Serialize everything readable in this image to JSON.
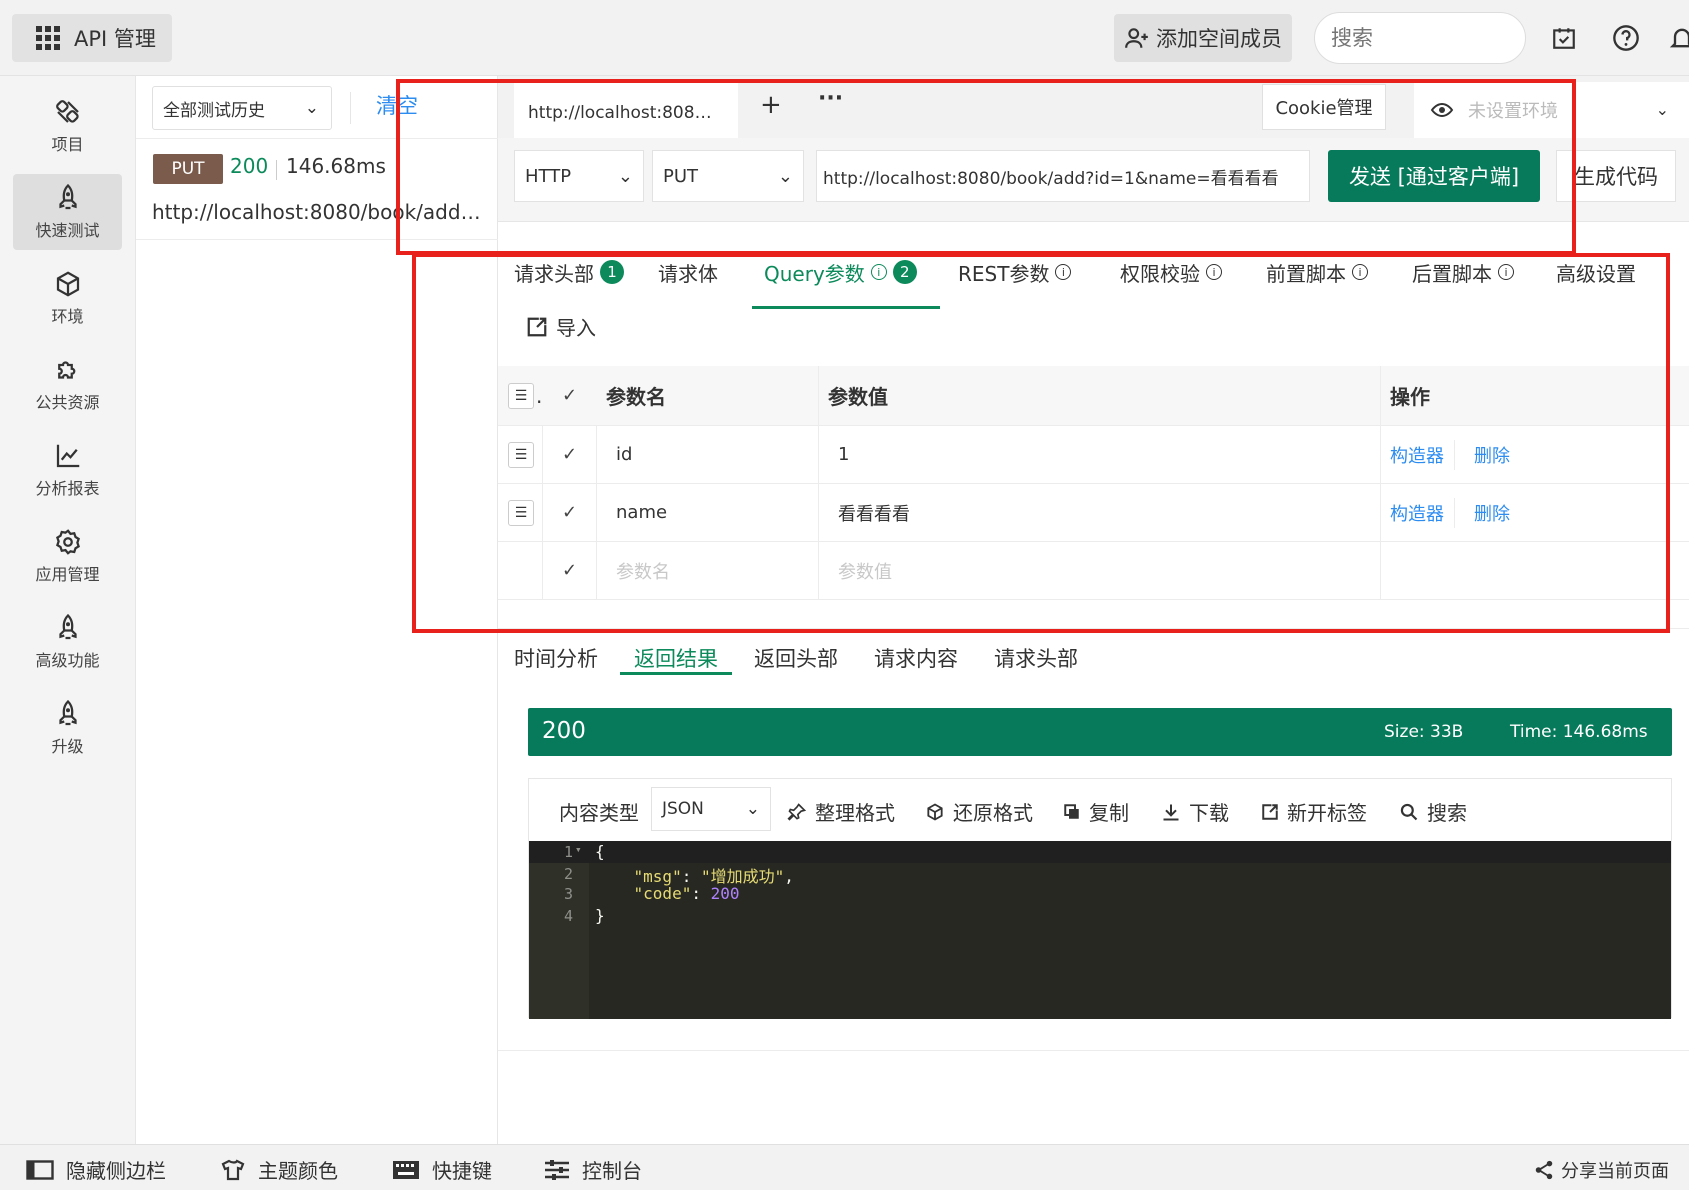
{
  "topbar": {
    "app_title": "API 管理",
    "add_member_label": "添加空间成员",
    "search_placeholder": "搜索"
  },
  "leftnav": [
    {
      "label": "项目",
      "icon": "project-icon"
    },
    {
      "label": "快速测试",
      "icon": "rocket-icon",
      "active": true
    },
    {
      "label": "环境",
      "icon": "cube-icon"
    },
    {
      "label": "公共资源",
      "icon": "puzzle-icon"
    },
    {
      "label": "分析报表",
      "icon": "chart-icon"
    },
    {
      "label": "应用管理",
      "icon": "gear-icon"
    },
    {
      "label": "高级功能",
      "icon": "rocket-icon"
    },
    {
      "label": "升级",
      "icon": "rocket-icon"
    }
  ],
  "history": {
    "filter_label": "全部测试历史",
    "clear_label": "清空",
    "items": [
      {
        "method": "PUT",
        "status": "200",
        "time": "146.68ms",
        "url": "http://localhost:8080/book/add?id=1&name=看看看看"
      }
    ]
  },
  "tabbar": {
    "active_tab": "http://localhost:8080/book/add?id=1&name=看看看看",
    "plus": "+",
    "more": "···",
    "cookie_label": "Cookie管理",
    "env_placeholder": "未设置环境"
  },
  "request": {
    "protocol": "HTTP",
    "method": "PUT",
    "url": "http://localhost:8080/book/add?id=1&name=看看看看",
    "send_label": "发送 [通过客户端]",
    "gen_code_label": "生成代码"
  },
  "param_tabs": [
    {
      "label": "请求头部",
      "count": "1"
    },
    {
      "label": "请求体"
    },
    {
      "label": "Query参数",
      "count": "2",
      "info": true,
      "active": true
    },
    {
      "label": "REST参数",
      "info": true
    },
    {
      "label": "权限校验",
      "info": true
    },
    {
      "label": "前置脚本",
      "info": true
    },
    {
      "label": "后置脚本",
      "info": true
    },
    {
      "label": "高级设置"
    }
  ],
  "import_label": "导入",
  "params_table": {
    "headers": {
      "name": "参数名",
      "value": "参数值",
      "ops": "操作"
    },
    "rows": [
      {
        "name": "id",
        "value": "1",
        "builder": "构造器",
        "delete": "删除"
      },
      {
        "name": "name",
        "value": "看看看看",
        "builder": "构造器",
        "delete": "删除"
      }
    ],
    "name_placeholder": "参数名",
    "value_placeholder": "参数值"
  },
  "result_tabs": [
    {
      "label": "时间分析"
    },
    {
      "label": "返回结果",
      "active": true
    },
    {
      "label": "返回头部"
    },
    {
      "label": "请求内容"
    },
    {
      "label": "请求头部"
    }
  ],
  "status": {
    "code": "200",
    "size": "Size: 33B",
    "time": "Time: 146.68ms"
  },
  "response_toolbar": {
    "content_type_label": "内容类型",
    "content_type": "JSON",
    "format": "整理格式",
    "restore": "还原格式",
    "copy": "复制",
    "download": "下载",
    "new_tab": "新开标签",
    "search": "搜索"
  },
  "response_body": {
    "lines": [
      "1",
      "2",
      "3",
      "4"
    ],
    "open": "{",
    "msg_key": "\"msg\"",
    "msg_value": "\"增加成功\"",
    "code_key": "\"code\"",
    "code_value": "200",
    "close": "}"
  },
  "bottom": {
    "hide_sidebar": "隐藏侧边栏",
    "theme_color": "主题颜色",
    "shortcuts": "快捷键",
    "console": "控制台",
    "share": "分享当前页面"
  },
  "colors": {
    "accent": "#067a5a",
    "link": "#2d8cf0",
    "put_badge": "#7b5b4b",
    "annotation": "#e8211d"
  }
}
